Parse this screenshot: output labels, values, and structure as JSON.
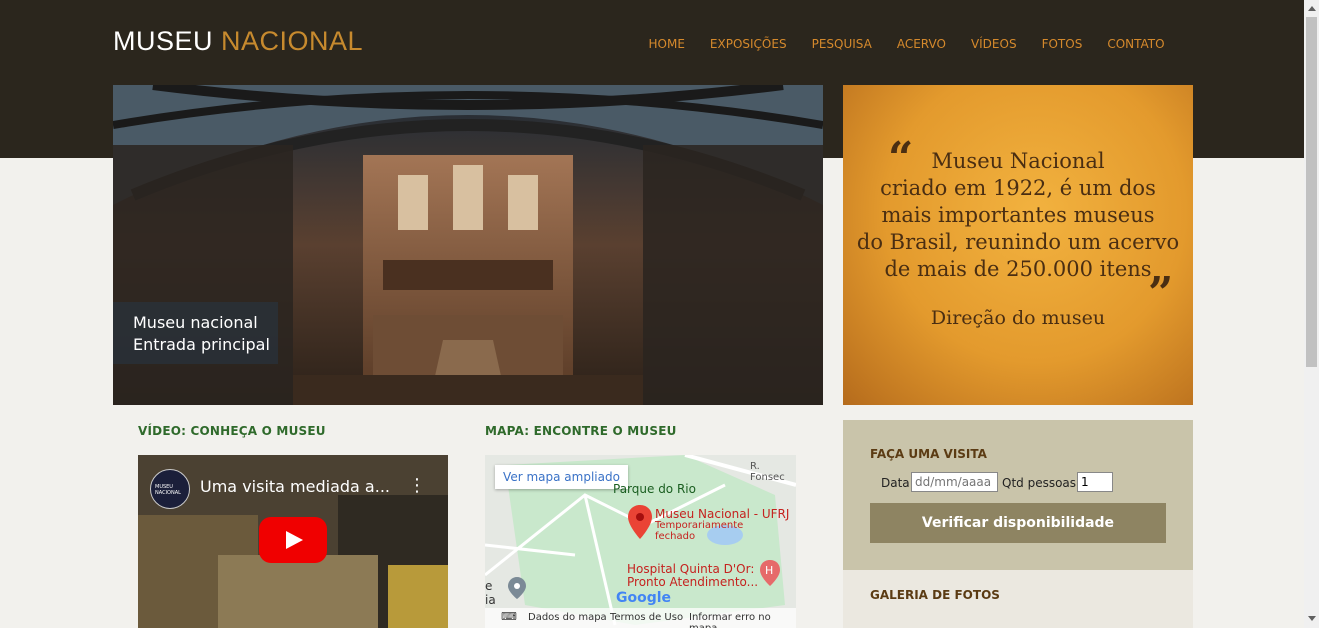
{
  "header": {
    "logo_part1": "MUSEU",
    "logo_part2": "NACIONAL",
    "nav": [
      "HOME",
      "EXPOSIÇÕES",
      "PESQUISA",
      "ACERVO",
      "VÍDEOS",
      "FOTOS",
      "CONTATO"
    ]
  },
  "hero": {
    "caption_line1": "Museu nacional",
    "caption_line2": "Entrada principal"
  },
  "quote": {
    "line1": "Museu Nacional",
    "line2": "criado em 1922, é um dos",
    "line3": "mais importantes museus",
    "line4": "do Brasil, reunindo um acervo",
    "line5": "de mais de 250.000 itens",
    "signature": "Direção do museu"
  },
  "video": {
    "heading": "VÍDEO: CONHEÇA O MUSEU",
    "title": "Uma visita mediada a...",
    "channel": "MUSEU NACIONAL"
  },
  "map": {
    "heading": "MAPA: ENCONTRE O MUSEU",
    "expand_label": "Ver mapa ampliado",
    "street": "R. Fonsec",
    "park": "Parque do Rio",
    "place_name": "Museu Nacional - UFRJ",
    "place_status1": "Temporariamente",
    "place_status2": "fechado",
    "hospital1": "Hospital Quinta D'Or:",
    "hospital2": "Pronto Atendimento...",
    "edge_e": "e",
    "edge_ia": "ia",
    "logo": "Google",
    "footer_data": "Dados do mapa",
    "footer_terms": "Termos de Uso",
    "footer_report": "Informar erro no mapa"
  },
  "visit": {
    "heading": "FAÇA UMA VISITA",
    "date_label": "Data",
    "date_placeholder": "dd/mm/aaaa",
    "qty_label": "Qtd pessoas",
    "qty_value": "1",
    "button": "Verificar disponibilidade"
  },
  "gallery": {
    "heading": "GALERIA DE FOTOS"
  },
  "colors": {
    "header_bg": "#2b261d",
    "accent": "#d5892c",
    "section_green": "#2f6a2b"
  }
}
